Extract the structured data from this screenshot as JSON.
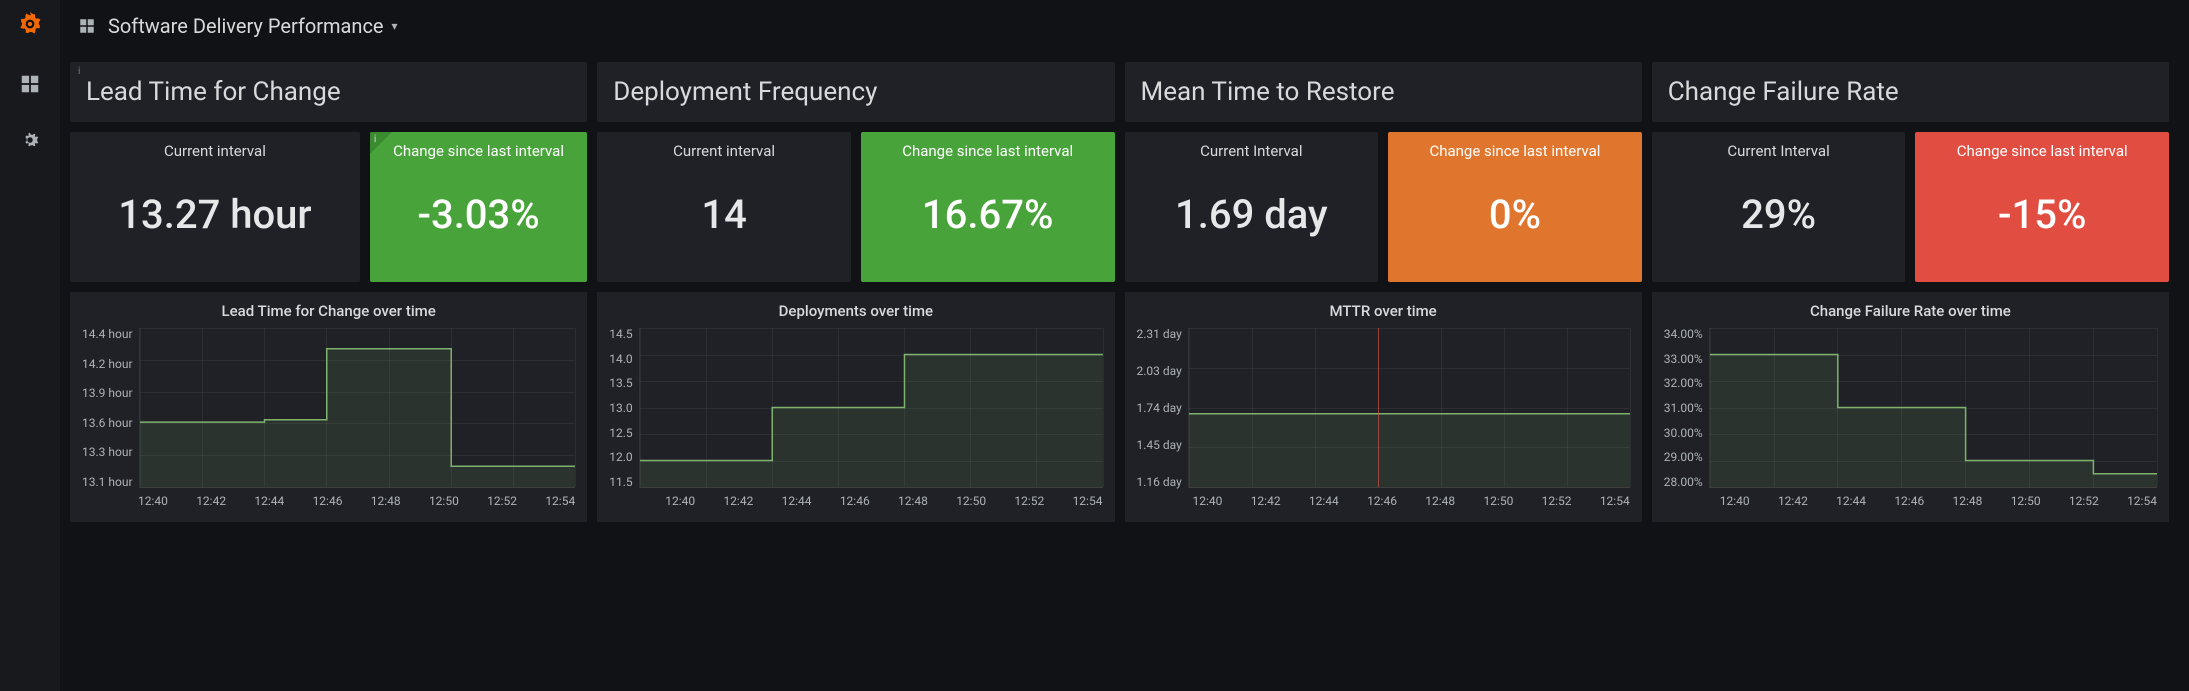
{
  "header": {
    "title": "Software Delivery Performance"
  },
  "sections": [
    {
      "title": "Lead Time for Change"
    },
    {
      "title": "Deployment Frequency"
    },
    {
      "title": "Mean Time to Restore"
    },
    {
      "title": "Change Failure Rate"
    }
  ],
  "stats": {
    "leadTime": {
      "currentLabel": "Current interval",
      "currentValue": "13.27 hour",
      "changeLabel": "Change since last interval",
      "changeValue": "-3.03%"
    },
    "deployFreq": {
      "currentLabel": "Current interval",
      "currentValue": "14",
      "changeLabel": "Change since last interval",
      "changeValue": "16.67%"
    },
    "mttr": {
      "currentLabel": "Current Interval",
      "currentValue": "1.69 day",
      "changeLabel": "Change since last interval",
      "changeValue": "0%"
    },
    "failRate": {
      "currentLabel": "Current Interval",
      "currentValue": "29%",
      "changeLabel": "Change since last interval",
      "changeValue": "-15%"
    }
  },
  "chartTitles": {
    "leadTime": "Lead Time for Change over time",
    "deployFreq": "Deployments over time",
    "mttr": "MTTR over time",
    "failRate": "Change Failure Rate over time"
  },
  "xTicks": [
    "12:40",
    "12:42",
    "12:44",
    "12:46",
    "12:48",
    "12:50",
    "12:52",
    "12:54"
  ],
  "chart_data": [
    {
      "type": "line",
      "title": "Lead Time for Change over time",
      "xlabel": "",
      "ylabel": "",
      "ylim": [
        13.1,
        14.4
      ],
      "y_ticks": [
        "14.4 hour",
        "14.2 hour",
        "13.9 hour",
        "13.6 hour",
        "13.3 hour",
        "13.1 hour"
      ],
      "x": [
        "12:40",
        "12:42",
        "12:44",
        "12:46",
        "12:48",
        "12:50",
        "12:52",
        "12:54"
      ],
      "values": [
        13.63,
        13.63,
        13.65,
        14.23,
        14.23,
        13.27,
        13.27,
        13.3
      ]
    },
    {
      "type": "line",
      "title": "Deployments over time",
      "xlabel": "",
      "ylabel": "",
      "ylim": [
        11.5,
        14.5
      ],
      "y_ticks": [
        "14.5",
        "14.0",
        "13.5",
        "13.0",
        "12.5",
        "12.0",
        "11.5"
      ],
      "x": [
        "12:40",
        "12:42",
        "12:44",
        "12:46",
        "12:48",
        "12:50",
        "12:52",
        "12:54"
      ],
      "values": [
        12.0,
        12.0,
        13.0,
        13.0,
        14.0,
        14.0,
        14.0,
        14.0
      ]
    },
    {
      "type": "line",
      "title": "MTTR over time",
      "xlabel": "",
      "ylabel": "",
      "ylim": [
        1.16,
        2.31
      ],
      "y_ticks": [
        "2.31 day",
        "2.03 day",
        "1.74 day",
        "1.45 day",
        "1.16 day"
      ],
      "x": [
        "12:40",
        "12:42",
        "12:44",
        "12:46",
        "12:48",
        "12:50",
        "12:52",
        "12:54"
      ],
      "values": [
        1.69,
        1.69,
        1.69,
        1.69,
        1.69,
        1.69,
        1.69,
        1.69
      ],
      "annotations": [
        {
          "type": "vline",
          "x": "12:46",
          "color": "red"
        }
      ]
    },
    {
      "type": "line",
      "title": "Change Failure Rate over time",
      "xlabel": "",
      "ylabel": "",
      "ylim": [
        28.0,
        34.0
      ],
      "y_ticks": [
        "34.00%",
        "33.00%",
        "32.00%",
        "31.00%",
        "30.00%",
        "29.00%",
        "28.00%"
      ],
      "x": [
        "12:40",
        "12:42",
        "12:44",
        "12:46",
        "12:48",
        "12:50",
        "12:52",
        "12:54"
      ],
      "values": [
        33.0,
        33.0,
        31.0,
        31.0,
        29.0,
        29.0,
        28.5,
        28.5
      ]
    }
  ]
}
